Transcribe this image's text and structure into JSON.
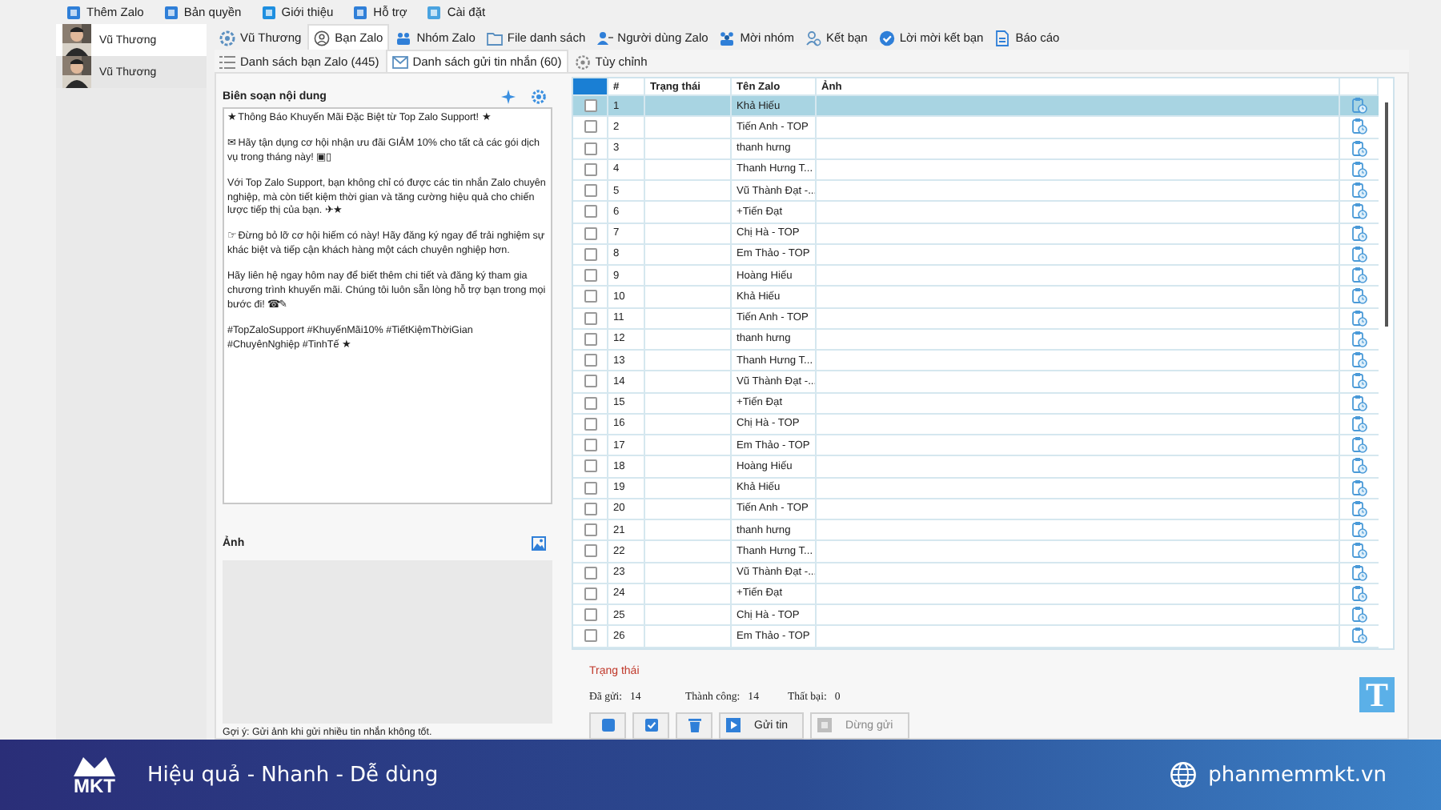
{
  "menu": [
    {
      "label": "Thêm Zalo"
    },
    {
      "label": "Bản quyền"
    },
    {
      "label": "Giới thiệu"
    },
    {
      "label": "Hỗ trợ"
    },
    {
      "label": "Cài đặt"
    }
  ],
  "accounts": [
    {
      "name": "Vũ Thương",
      "selected": true
    },
    {
      "name": "Vũ Thương",
      "selected": false
    }
  ],
  "tabs": [
    {
      "label": "Vũ Thương",
      "selected": false
    },
    {
      "label": "Bạn Zalo",
      "selected": true
    },
    {
      "label": "Nhóm Zalo",
      "selected": false
    },
    {
      "label": "File danh sách",
      "selected": false
    },
    {
      "label": "Người dùng Zalo",
      "selected": false
    },
    {
      "label": "Mời nhóm",
      "selected": false
    },
    {
      "label": "Kết bạn",
      "selected": false
    },
    {
      "label": "Lời mời kết bạn",
      "selected": false
    },
    {
      "label": "Báo cáo",
      "selected": false
    }
  ],
  "subtabs": [
    {
      "label": "Danh sách bạn Zalo (445)",
      "selected": false
    },
    {
      "label": "Danh sách gửi tin nhắn (60)",
      "selected": true
    },
    {
      "label": "Tùy chỉnh",
      "selected": false
    }
  ],
  "editor": {
    "title": "Biên soạn nội dung",
    "paragraphs": [
      "★ Thông Báo Khuyến Mãi Đặc Biệt từ Top Zalo Support! ★",
      "✉ Hãy tận dụng cơ hội nhận ưu đãi GIẢM 10% cho tất cả các gói dịch vụ trong tháng này! ▣▯",
      "Với Top Zalo Support, bạn không chỉ có được các tin nhắn Zalo chuyên nghiệp, mà còn tiết kiệm thời gian và tăng cường hiệu quả cho chiến lược tiếp thị của bạn. ✈★",
      "☞ Đừng bỏ lỡ cơ hội hiếm có này! Hãy đăng ký ngay để trải nghiệm sự khác biệt và tiếp cận khách hàng một cách chuyên nghiệp hơn.",
      "Hãy liên hệ ngay hôm nay để biết thêm chi tiết và đăng ký tham gia chương trình khuyến mãi. Chúng tôi luôn sẵn lòng hỗ trợ bạn trong mọi bước đi! ☎✎",
      "#TopZaloSupport #KhuyếnMãi10% #TiếtKiệmThờiGian #ChuyênNghiệp #TinhTế ★"
    ]
  },
  "image_panel": {
    "title": "Ảnh",
    "hint": "Gợi ý: Gửi ảnh khi gửi nhiều tin nhắn không tốt."
  },
  "table": {
    "columns": [
      "#",
      "Trạng thái",
      "Tên Zalo",
      "Ảnh"
    ],
    "rows": [
      {
        "number": "1",
        "name": "Khả Hiếu",
        "checked": false,
        "selected": true
      },
      {
        "number": "2",
        "name": "Tiến Anh - TOP",
        "checked": false,
        "selected": false
      },
      {
        "number": "3",
        "name": "thanh hưng",
        "checked": false,
        "selected": false
      },
      {
        "number": "4",
        "name": "Thanh Hưng T...",
        "checked": false,
        "selected": false
      },
      {
        "number": "5",
        "name": "Vũ Thành Đạt -...",
        "checked": false,
        "selected": false
      },
      {
        "number": "6",
        "name": "+Tiến Đạt",
        "checked": false,
        "selected": false
      },
      {
        "number": "7",
        "name": "Chị Hà - TOP",
        "checked": false,
        "selected": false
      },
      {
        "number": "8",
        "name": "Em Thảo - TOP",
        "checked": false,
        "selected": false
      },
      {
        "number": "9",
        "name": "Hoàng Hiếu",
        "checked": false,
        "selected": false
      },
      {
        "number": "10",
        "name": "Khả Hiếu",
        "checked": false,
        "selected": false
      },
      {
        "number": "11",
        "name": "Tiến Anh - TOP",
        "checked": false,
        "selected": false
      },
      {
        "number": "12",
        "name": "thanh hưng",
        "checked": false,
        "selected": false
      },
      {
        "number": "13",
        "name": "Thanh Hưng T...",
        "checked": false,
        "selected": false
      },
      {
        "number": "14",
        "name": "Vũ Thành Đạt -...",
        "checked": false,
        "selected": false
      },
      {
        "number": "15",
        "name": "+Tiến Đạt",
        "checked": false,
        "selected": false
      },
      {
        "number": "16",
        "name": "Chị Hà - TOP",
        "checked": false,
        "selected": false
      },
      {
        "number": "17",
        "name": "Em Thảo - TOP",
        "checked": false,
        "selected": false
      },
      {
        "number": "18",
        "name": "Hoàng Hiếu",
        "checked": false,
        "selected": false
      },
      {
        "number": "19",
        "name": "Khả Hiếu",
        "checked": false,
        "selected": false
      },
      {
        "number": "20",
        "name": "Tiến Anh - TOP",
        "checked": false,
        "selected": false
      },
      {
        "number": "21",
        "name": "thanh hưng",
        "checked": false,
        "selected": false
      },
      {
        "number": "22",
        "name": "Thanh Hưng T...",
        "checked": false,
        "selected": false
      },
      {
        "number": "23",
        "name": "Vũ Thành Đạt -...",
        "checked": false,
        "selected": false
      },
      {
        "number": "24",
        "name": "+Tiến Đạt",
        "checked": false,
        "selected": false
      },
      {
        "number": "25",
        "name": "Chị Hà - TOP",
        "checked": false,
        "selected": false
      },
      {
        "number": "26",
        "name": "Em Thảo - TOP",
        "checked": false,
        "selected": false
      }
    ]
  },
  "status": {
    "title": "Trạng thái",
    "stats": [
      {
        "label": "Đã gửi:",
        "value": "14"
      },
      {
        "label": "Thành công:",
        "value": "14"
      },
      {
        "label": "Thất bại:",
        "value": "0"
      }
    ]
  },
  "buttons": [
    {
      "kind": "select-all",
      "disabled": false
    },
    {
      "kind": "check",
      "disabled": false
    },
    {
      "kind": "delete",
      "disabled": false
    },
    {
      "kind": "send",
      "label": "Gửi tin",
      "disabled": false
    },
    {
      "kind": "stop",
      "label": "Dừng gửi",
      "disabled": true
    }
  ],
  "badge": "T",
  "banner": {
    "logo": "MKT",
    "slogan": "Hiệu quả - Nhanh - Dễ dùng",
    "website": "phanmemmkt.vn"
  }
}
